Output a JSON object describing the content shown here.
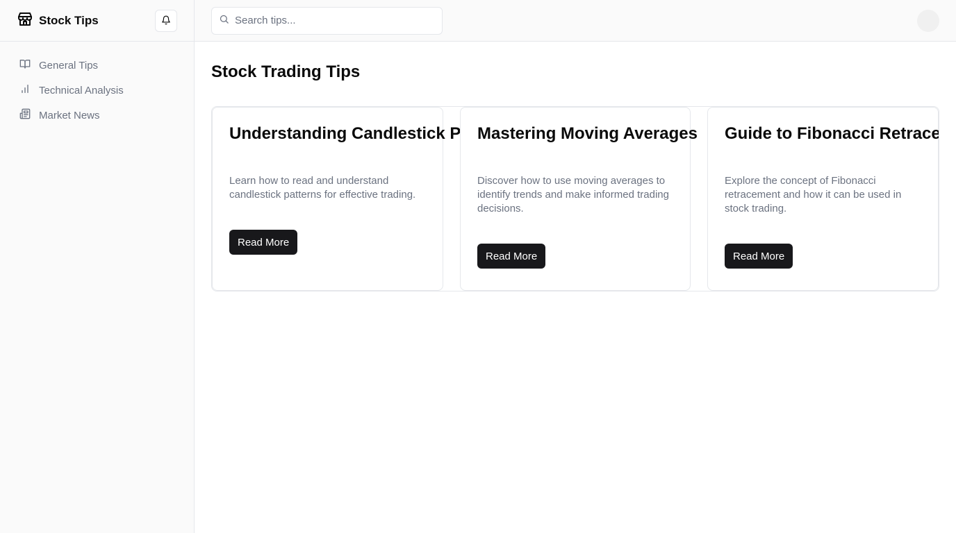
{
  "sidebar": {
    "brand_icon": "store-icon",
    "brand_name": "Stock Tips",
    "notification_icon": "bell-icon",
    "nav": [
      {
        "label": "General Tips",
        "icon": "book-open-icon"
      },
      {
        "label": "Technical Analysis",
        "icon": "bar-chart-icon"
      },
      {
        "label": "Market News",
        "icon": "newspaper-icon"
      }
    ]
  },
  "topbar": {
    "search_placeholder": "Search tips...",
    "search_icon": "search-icon"
  },
  "main": {
    "title": "Stock Trading Tips",
    "cards": [
      {
        "title": "Understanding Candlestick Patterns",
        "description": "Learn how to read and understand candlestick patterns for effective trading.",
        "button": "Read More"
      },
      {
        "title": "Mastering Moving Averages",
        "description": "Discover how to use moving averages to identify trends and make informed trading decisions.",
        "button": "Read More"
      },
      {
        "title": "Guide to Fibonacci Retracement",
        "description": "Explore the concept of Fibonacci retracement and how it can be used in stock trading.",
        "button": "Read More"
      }
    ]
  },
  "colors": {
    "sidebar_bg": "#fafafa",
    "border": "#e5e7eb",
    "muted_text": "#6b7280",
    "button_bg": "#18181b"
  }
}
